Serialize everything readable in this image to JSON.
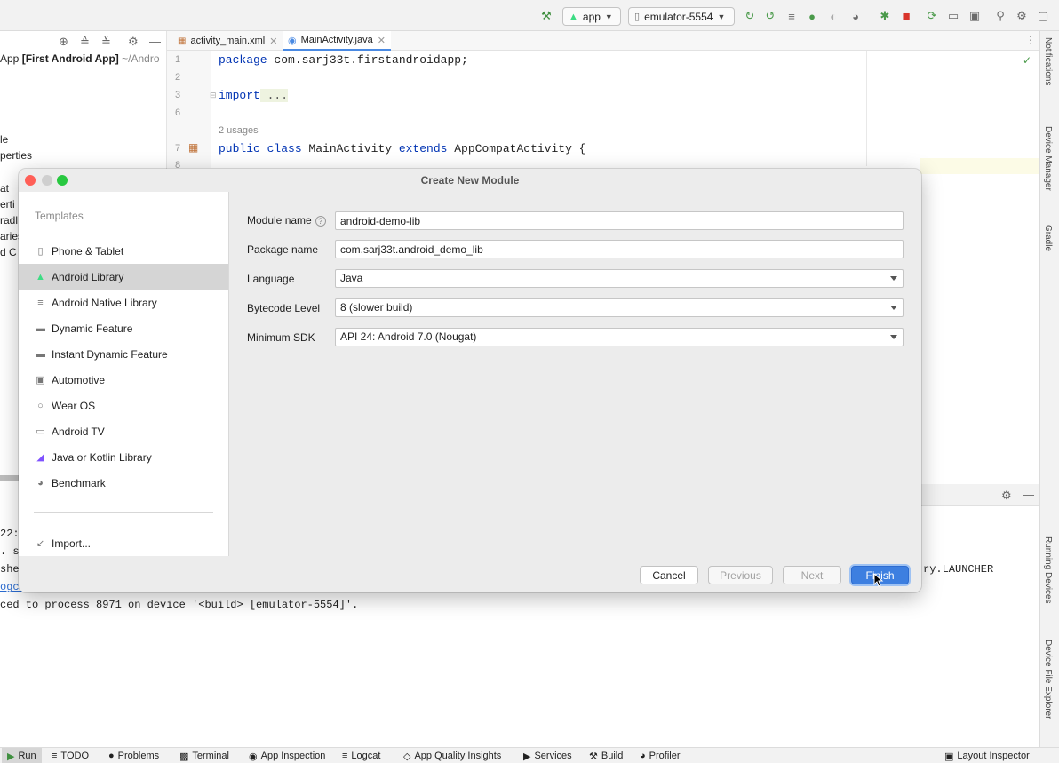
{
  "toolbar": {
    "run_config": "app",
    "device": "emulator-5554"
  },
  "project": {
    "header_prefix": "App",
    "header_bold": "[First Android App]",
    "header_path": "~/Andro",
    "lines": [
      "le",
      "perties",
      "at",
      "erti",
      "radl",
      "aries",
      "d C"
    ]
  },
  "editor": {
    "tabs": [
      {
        "label": "activity_main.xml"
      },
      {
        "label": "MainActivity.java"
      }
    ],
    "line_numbers": [
      "1",
      "2",
      "3",
      "6",
      "7",
      "8"
    ],
    "usages": "2 usages",
    "code": {
      "l1_kw": "package",
      "l1_rest": " com.sarj33t.firstandroidapp;",
      "l3_kw": "import",
      "l3_rest": " ...",
      "l7_kw1": "public class",
      "l7_mid": " MainActivity ",
      "l7_kw2": "extends",
      "l7_rest": " AppCompatActivity {"
    }
  },
  "right_tools": [
    "Notifications",
    "Device Manager",
    "Gradle",
    "Running Devices",
    "Device File Explorer"
  ],
  "console": {
    "lines": [
      "22:4",
      ". su",
      "she",
      "ogca"
    ],
    "tail_right": "ry.LAUNCHER",
    "last_line": "ced to process 8971 on device '<build> [emulator-5554]'."
  },
  "bottom_bar": {
    "items": [
      "Run",
      "TODO",
      "Problems",
      "Terminal",
      "App Inspection",
      "Logcat",
      "App Quality Insights",
      "Services",
      "Build",
      "Profiler"
    ],
    "right": "Layout Inspector"
  },
  "dialog": {
    "title": "Create New Module",
    "templates_header": "Templates",
    "templates": [
      "Phone & Tablet",
      "Android Library",
      "Android Native Library",
      "Dynamic Feature",
      "Instant Dynamic Feature",
      "Automotive",
      "Wear OS",
      "Android TV",
      "Java or Kotlin Library",
      "Benchmark"
    ],
    "import_label": "Import...",
    "form": {
      "module_name_label": "Module name",
      "module_name_value": "android-demo-lib",
      "package_name_label": "Package name",
      "package_name_value": "com.sarj33t.android_demo_lib",
      "language_label": "Language",
      "language_value": "Java",
      "bytecode_label": "Bytecode Level",
      "bytecode_value": "8 (slower build)",
      "min_sdk_label": "Minimum SDK",
      "min_sdk_value": "API 24: Android 7.0 (Nougat)"
    },
    "buttons": {
      "cancel": "Cancel",
      "previous": "Previous",
      "next": "Next",
      "finish": "Finish"
    }
  },
  "colors": {
    "accent": "#3d7fe0",
    "keyword": "#0033b3",
    "selection": "#d5d5d5"
  }
}
